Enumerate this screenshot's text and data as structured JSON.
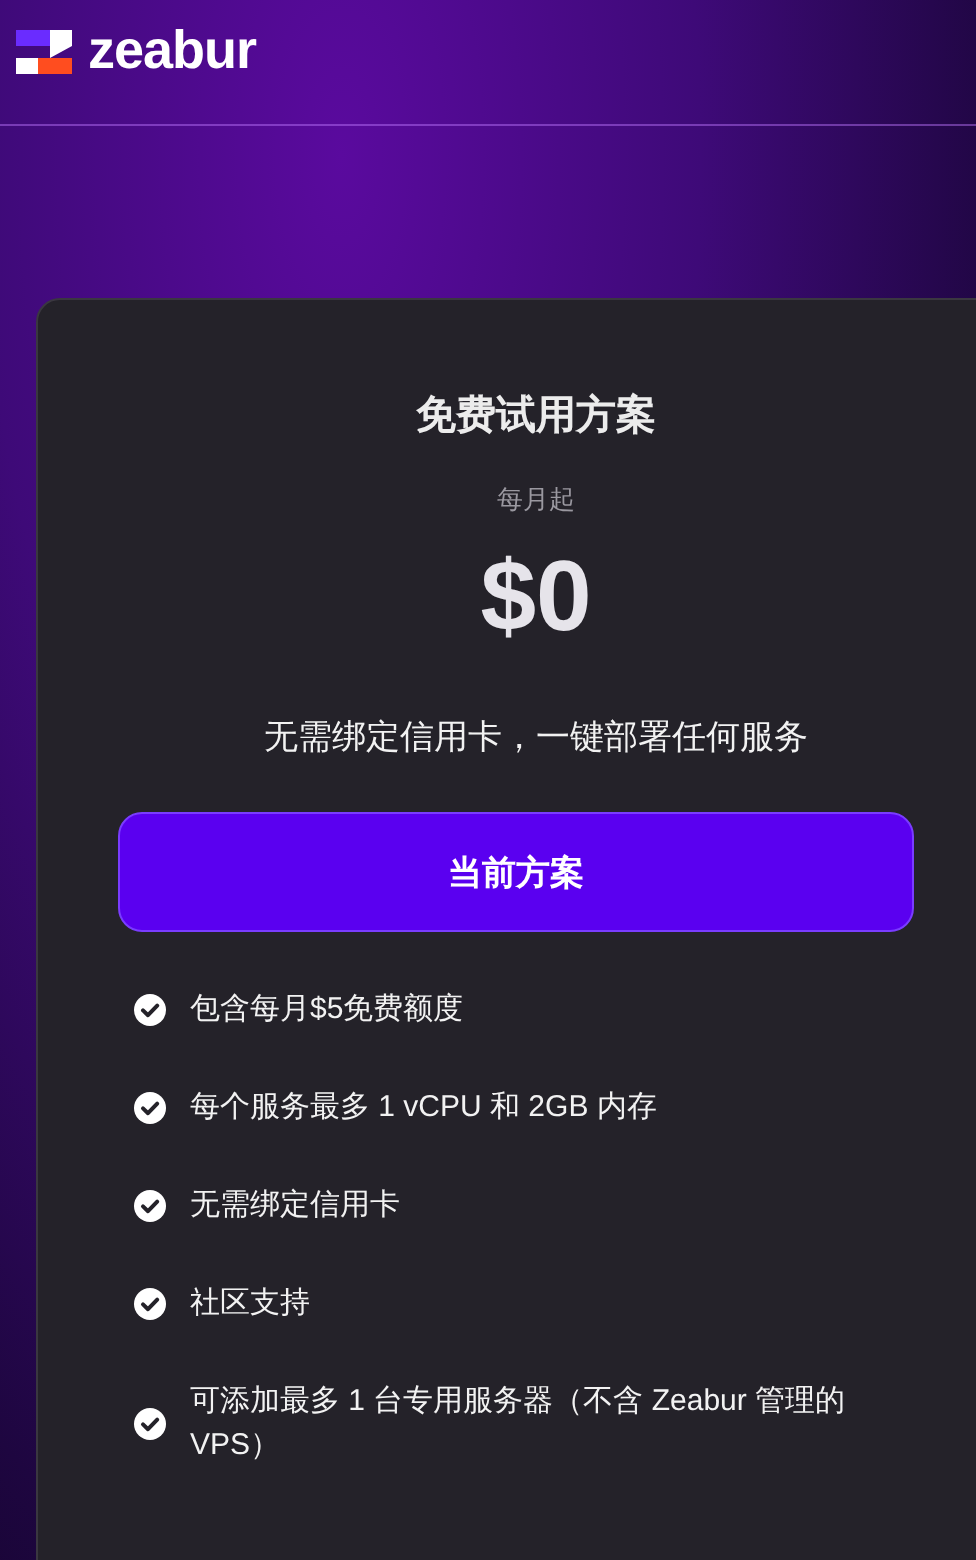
{
  "header": {
    "brand": "zeabur"
  },
  "plan": {
    "title": "免费试用方案",
    "price_note": "每月起",
    "price": "$0",
    "tagline": "无需绑定信用卡，一键部署任何服务",
    "button": {
      "label": "当前方案"
    },
    "features": [
      {
        "text": "包含每月$5免费额度"
      },
      {
        "text": "每个服务最多 1 vCPU 和 2GB 内存"
      },
      {
        "text": "无需绑定信用卡"
      },
      {
        "text": "社区支持"
      },
      {
        "text": "可添加最多 1 台专用服务器（不含 Zeabur 管理的 VPS）"
      }
    ]
  }
}
